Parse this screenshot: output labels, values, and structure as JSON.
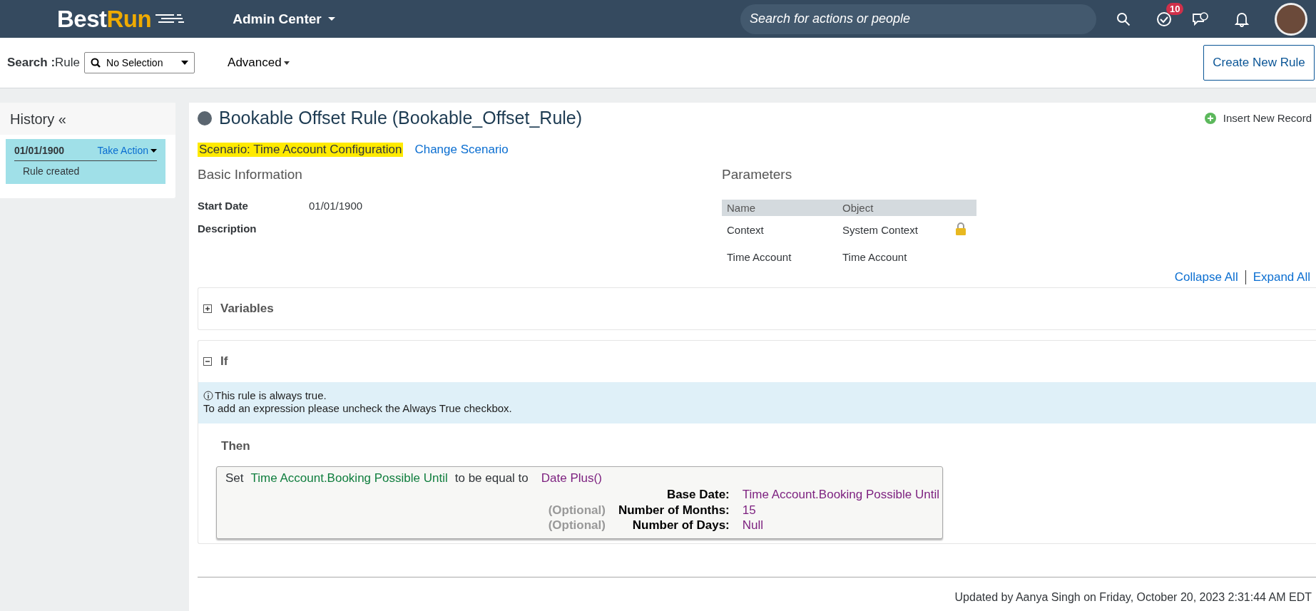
{
  "header": {
    "logo": {
      "part_1": "Best",
      "part_2": "Run"
    },
    "app_menu": "Admin Center",
    "search": {
      "placeholder": "Search for actions or people"
    },
    "todo_badge": "10"
  },
  "toolbar": {
    "search_label": "Search :",
    "search_type": "Rule",
    "selector": "No Selection",
    "advanced": "Advanced",
    "create_button": "Create New Rule"
  },
  "history": {
    "title": "History «",
    "entries": [
      {
        "date": "01/01/1900",
        "action": "Take Action",
        "note": "Rule created",
        "selected": true
      }
    ]
  },
  "rule": {
    "title": "Bookable Offset Rule (Bookable_Offset_Rule)",
    "insert": "Insert New Record",
    "scenario": "Scenario: Time Account Configuration",
    "change_scenario": "Change Scenario",
    "basic": {
      "title": "Basic Information",
      "fields": [
        {
          "label": "Start Date",
          "value": "01/01/1900"
        },
        {
          "label": "Description"
        }
      ]
    },
    "parameters": {
      "title": "Parameters",
      "columns": [
        "Name",
        "Object"
      ],
      "rows": [
        {
          "name": "Context",
          "object": "System Context",
          "locked": true
        },
        {
          "name": "Time Account",
          "object": "Time Account",
          "locked": false
        }
      ]
    },
    "collapse_all": "Collapse All",
    "expand_all": "Expand All",
    "sections": [
      {
        "title": "Variables",
        "expanded": false
      },
      {
        "title": "If",
        "expanded": true
      }
    ],
    "info": [
      "This rule is always true.",
      "To add an expression please uncheck the Always True checkbox."
    ],
    "then": {
      "title": "Then",
      "set": "Set",
      "target": "Time Account.Booking Possible Until",
      "verb": "to be equal to",
      "function": "Date Plus()",
      "args": [
        {
          "label": "Base Date:",
          "value": "Time Account.Booking Possible Until"
        },
        {
          "optional": "(Optional)",
          "label": "Number of Months:",
          "value": "15"
        },
        {
          "optional": "(Optional)",
          "label": "Number of Days:",
          "value": "Null"
        }
      ]
    },
    "footer": "Updated by Aanya Singh on Friday, October 20, 2023 2:31:44 AM EDT"
  }
}
